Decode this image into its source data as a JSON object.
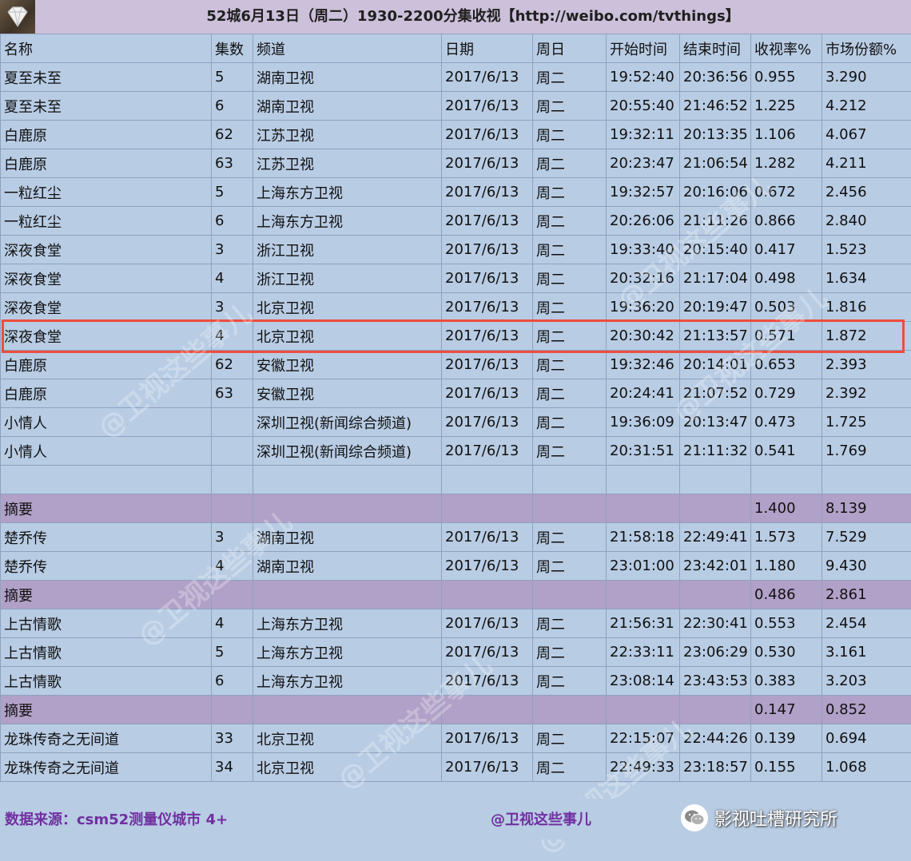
{
  "header": {
    "title": "52城6月13日（周二）1930-2200分集收视【http://weibo.com/tvthings】",
    "logo_icon": "diamond-logo-icon"
  },
  "table": {
    "columns": [
      "名称",
      "集数",
      "频道",
      "日期",
      "周日",
      "开始时间",
      "结束时间",
      "收视率%",
      "市场份额%"
    ],
    "rows": [
      {
        "type": "data",
        "cells": [
          "夏至未至",
          "5",
          "湖南卫视",
          "2017/6/13",
          "周二",
          "19:52:40",
          "20:36:56",
          "0.955",
          "3.290"
        ]
      },
      {
        "type": "data",
        "cells": [
          "夏至未至",
          "6",
          "湖南卫视",
          "2017/6/13",
          "周二",
          "20:55:40",
          "21:46:52",
          "1.225",
          "4.212"
        ]
      },
      {
        "type": "data",
        "cells": [
          "白鹿原",
          "62",
          "江苏卫视",
          "2017/6/13",
          "周二",
          "19:32:11",
          "20:13:35",
          "1.106",
          "4.067"
        ]
      },
      {
        "type": "data",
        "cells": [
          "白鹿原",
          "63",
          "江苏卫视",
          "2017/6/13",
          "周二",
          "20:23:47",
          "21:06:54",
          "1.282",
          "4.211"
        ]
      },
      {
        "type": "data",
        "cells": [
          "一粒红尘",
          "5",
          "上海东方卫视",
          "2017/6/13",
          "周二",
          "19:32:57",
          "20:16:06",
          "0.672",
          "2.456"
        ]
      },
      {
        "type": "data",
        "cells": [
          "一粒红尘",
          "6",
          "上海东方卫视",
          "2017/6/13",
          "周二",
          "20:26:06",
          "21:11:26",
          "0.866",
          "2.840"
        ]
      },
      {
        "type": "data",
        "cells": [
          "深夜食堂",
          "3",
          "浙江卫视",
          "2017/6/13",
          "周二",
          "19:33:40",
          "20:15:40",
          "0.417",
          "1.523"
        ]
      },
      {
        "type": "data",
        "cells": [
          "深夜食堂",
          "4",
          "浙江卫视",
          "2017/6/13",
          "周二",
          "20:32:16",
          "21:17:04",
          "0.498",
          "1.634"
        ]
      },
      {
        "type": "data",
        "cells": [
          "深夜食堂",
          "3",
          "北京卫视",
          "2017/6/13",
          "周二",
          "19:36:20",
          "20:19:47",
          "0.503",
          "1.816"
        ]
      },
      {
        "type": "data",
        "cells": [
          "深夜食堂",
          "4",
          "北京卫视",
          "2017/6/13",
          "周二",
          "20:30:42",
          "21:13:57",
          "0.571",
          "1.872"
        ]
      },
      {
        "type": "data",
        "cells": [
          "白鹿原",
          "62",
          "安徽卫视",
          "2017/6/13",
          "周二",
          "19:32:46",
          "20:14:01",
          "0.653",
          "2.393"
        ]
      },
      {
        "type": "data",
        "cells": [
          "白鹿原",
          "63",
          "安徽卫视",
          "2017/6/13",
          "周二",
          "20:24:41",
          "21:07:52",
          "0.729",
          "2.392"
        ]
      },
      {
        "type": "data",
        "cells": [
          "小情人",
          "",
          "深圳卫视(新闻综合频道)",
          "2017/6/13",
          "周二",
          "19:36:09",
          "20:13:47",
          "0.473",
          "1.725"
        ]
      },
      {
        "type": "data",
        "cells": [
          "小情人",
          "",
          "深圳卫视(新闻综合频道)",
          "2017/6/13",
          "周二",
          "20:31:51",
          "21:11:32",
          "0.541",
          "1.769"
        ]
      },
      {
        "type": "blank",
        "cells": [
          "",
          "",
          "",
          "",
          "",
          "",
          "",
          "",
          ""
        ]
      },
      {
        "type": "summary",
        "cells": [
          "摘要",
          "",
          "",
          "",
          "",
          "",
          "",
          "1.400",
          "8.139"
        ]
      },
      {
        "type": "data",
        "cells": [
          "楚乔传",
          "3",
          "湖南卫视",
          "2017/6/13",
          "周二",
          "21:58:18",
          "22:49:41",
          "1.573",
          "7.529"
        ]
      },
      {
        "type": "data",
        "cells": [
          "楚乔传",
          "4",
          "湖南卫视",
          "2017/6/13",
          "周二",
          "23:01:00",
          "23:42:01",
          "1.180",
          "9.430"
        ]
      },
      {
        "type": "summary",
        "cells": [
          "摘要",
          "",
          "",
          "",
          "",
          "",
          "",
          "0.486",
          "2.861"
        ]
      },
      {
        "type": "data",
        "cells": [
          "上古情歌",
          "4",
          "上海东方卫视",
          "2017/6/13",
          "周二",
          "21:56:31",
          "22:30:41",
          "0.553",
          "2.454"
        ]
      },
      {
        "type": "data",
        "cells": [
          "上古情歌",
          "5",
          "上海东方卫视",
          "2017/6/13",
          "周二",
          "22:33:11",
          "23:06:29",
          "0.530",
          "3.161"
        ]
      },
      {
        "type": "data",
        "cells": [
          "上古情歌",
          "6",
          "上海东方卫视",
          "2017/6/13",
          "周二",
          "23:08:14",
          "23:43:53",
          "0.383",
          "3.203"
        ]
      },
      {
        "type": "summary",
        "cells": [
          "摘要",
          "",
          "",
          "",
          "",
          "",
          "",
          "0.147",
          "0.852"
        ]
      },
      {
        "type": "data",
        "cells": [
          "龙珠传奇之无间道",
          "33",
          "北京卫视",
          "2017/6/13",
          "周二",
          "22:15:07",
          "22:44:26",
          "0.139",
          "0.694"
        ]
      },
      {
        "type": "data",
        "cells": [
          "龙珠传奇之无间道",
          "34",
          "北京卫视",
          "2017/6/13",
          "周二",
          "22:49:33",
          "23:18:57",
          "0.155",
          "1.068"
        ]
      }
    ],
    "highlighted_row": 9,
    "highlight_color": "#ee4d3d"
  },
  "footer": {
    "source": "数据来源：csm52测量仪城市 4+",
    "credit": "@卫视这些事儿",
    "wechat_icon": "wechat-icon",
    "wechat_name": "影视吐槽研究所"
  },
  "watermark": {
    "text": "@卫视这些事儿"
  },
  "colors": {
    "background": "#b8cce4",
    "header": "#ccc0da",
    "summary_row": "#b1a0c7",
    "footer_text": "#7030a0"
  }
}
